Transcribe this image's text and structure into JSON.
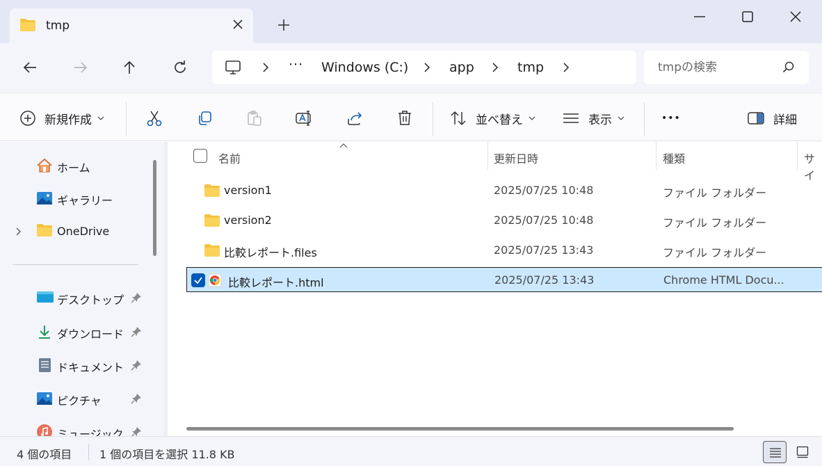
{
  "tab": {
    "title": "tmp"
  },
  "address": {
    "more": "···",
    "crumbs": [
      "Windows (C:)",
      "app",
      "tmp"
    ]
  },
  "search": {
    "placeholder": "tmpの検索"
  },
  "toolbar": {
    "new_label": "新規作成",
    "sort_label": "並べ替え",
    "view_label": "表示",
    "more": "•••",
    "details_label": "詳細"
  },
  "sidebar": {
    "home": "ホーム",
    "gallery": "ギャラリー",
    "onedrive": "OneDrive",
    "quick": [
      "デスクトップ",
      "ダウンロード",
      "ドキュメント",
      "ピクチャ",
      "ミュージック"
    ]
  },
  "columns": {
    "name": "名前",
    "date": "更新日時",
    "type": "種類",
    "size": "サイ"
  },
  "files": [
    {
      "name": "version1",
      "date": "2025/07/25 10:48",
      "type": "ファイル フォルダー",
      "kind": "folder-icon"
    },
    {
      "name": "version2",
      "date": "2025/07/25 10:48",
      "type": "ファイル フォルダー",
      "kind": "folder-icon"
    },
    {
      "name": "比較レポート.files",
      "date": "2025/07/25 13:43",
      "type": "ファイル フォルダー",
      "kind": "folder-icon"
    },
    {
      "name": "比較レポート.html",
      "date": "2025/07/25 13:43",
      "type": "Chrome HTML Docu...",
      "kind": "chrome-icon",
      "selected": true
    }
  ],
  "status": {
    "count": "4 個の項目",
    "selection": "1 個の項目を選択  11.8 KB"
  },
  "colors": {
    "accent": "#0058b8",
    "selection": "#cce8ff",
    "folder": "#f5c242",
    "titlebar": "#e3e8f4"
  }
}
